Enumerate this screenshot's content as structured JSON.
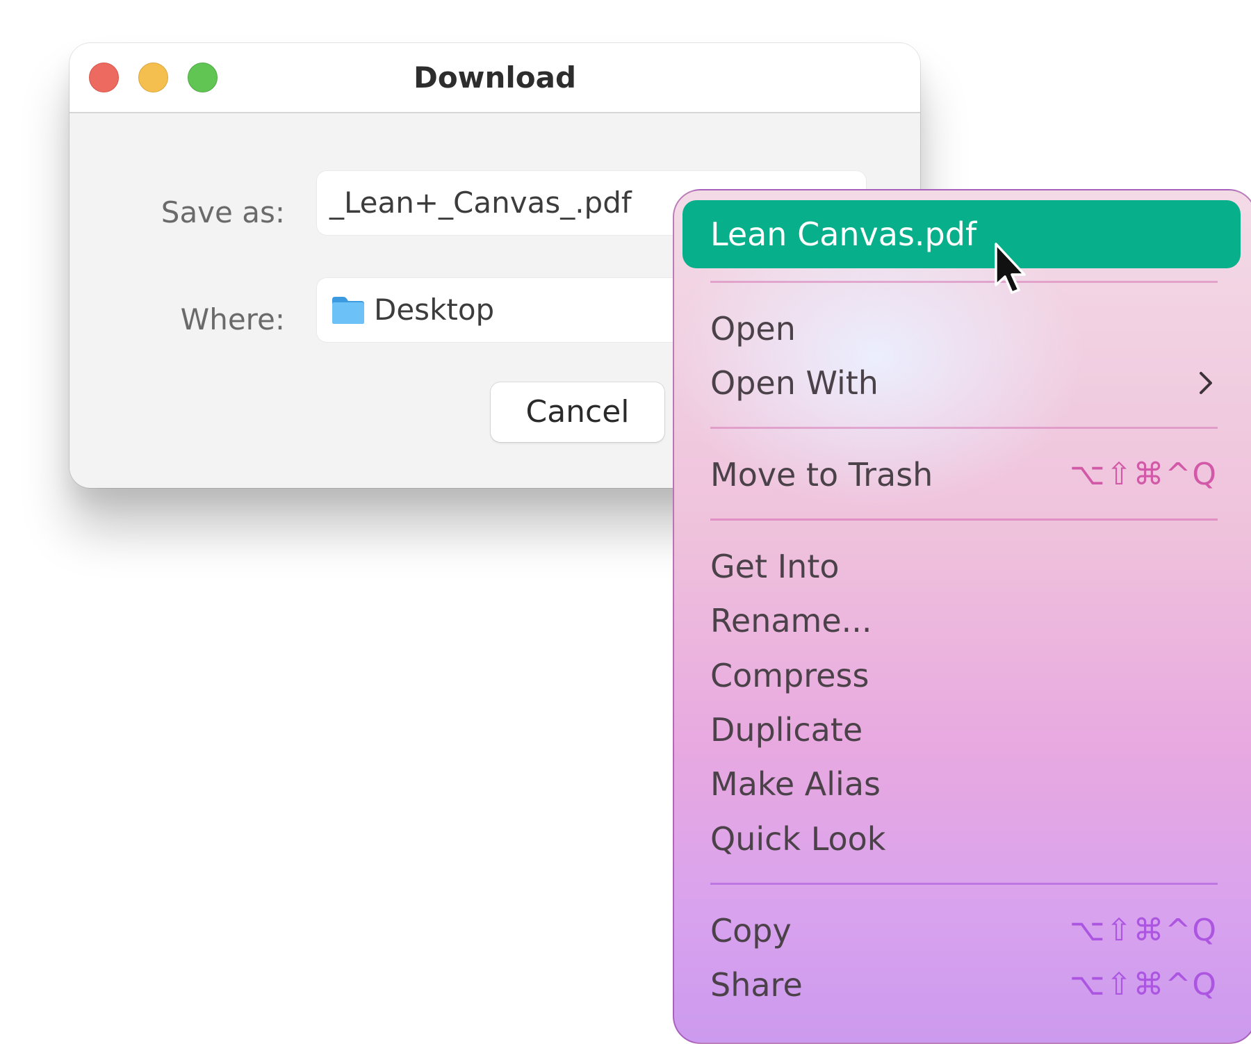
{
  "dialog": {
    "title": "Download",
    "save_as_label": "Save as:",
    "save_as_value": "_Lean+_Canvas_.pdf",
    "where_label": "Where:",
    "where_value": "Desktop",
    "where_icon": "folder-icon",
    "cancel_label": "Cancel"
  },
  "menu": {
    "title": "Lean Canvas.pdf",
    "accent_color": "#07af8a",
    "items": [
      {
        "label": "Open"
      },
      {
        "label": "Open With",
        "icon": "chevron-right-icon"
      },
      {
        "label": "Move to Trash",
        "shortcut": "⌥⇧⌘^Q"
      },
      {
        "label": "Get Into"
      },
      {
        "label": "Rename..."
      },
      {
        "label": "Compress"
      },
      {
        "label": "Duplicate"
      },
      {
        "label": "Make Alias"
      },
      {
        "label": "Quick Look"
      },
      {
        "label": "Copy",
        "shortcut": "⌥⇧⌘^Q"
      },
      {
        "label": "Share",
        "shortcut": "⌥⇧⌘^Q"
      }
    ]
  }
}
